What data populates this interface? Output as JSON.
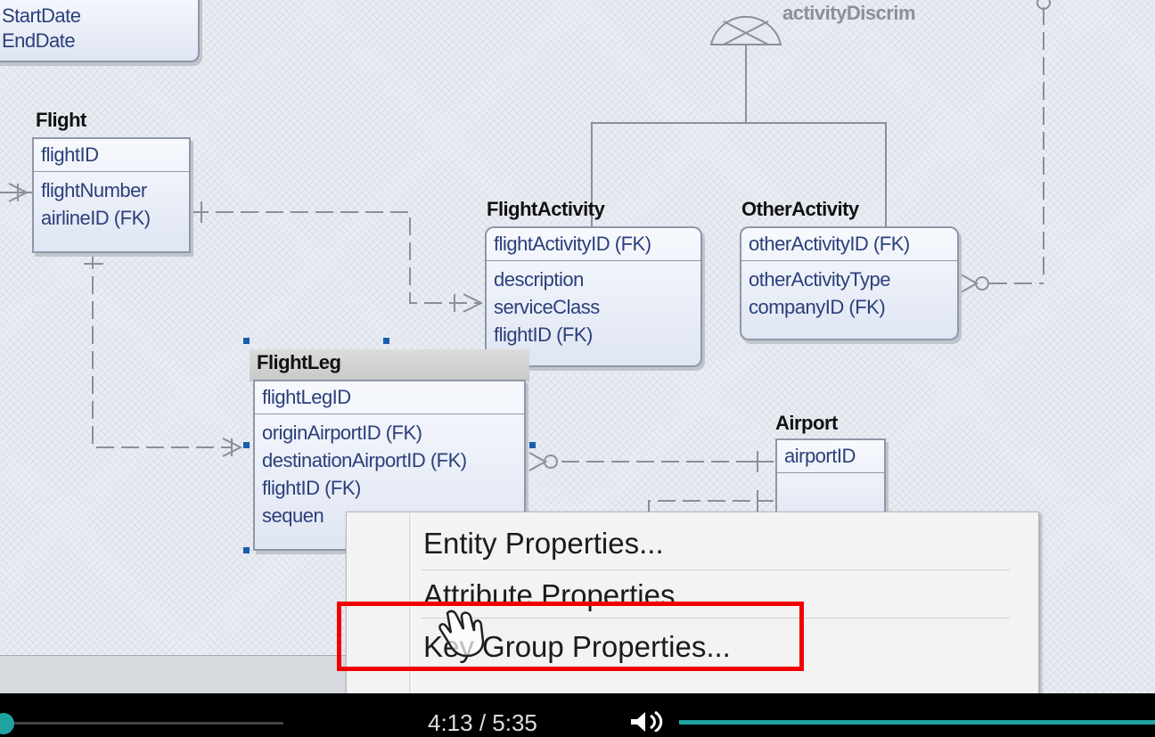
{
  "diagram": {
    "partial_entity": {
      "attributes": [
        "StartDate",
        "EndDate"
      ]
    },
    "discriminator_label": "activityDiscrim",
    "entities": {
      "flight": {
        "name": "Flight",
        "key": "flightID",
        "attributes": [
          "flightNumber",
          "airlineID (FK)"
        ]
      },
      "flight_activity": {
        "name": "FlightActivity",
        "key": "flightActivityID (FK)",
        "attributes": [
          "description",
          "serviceClass",
          "flightID (FK)"
        ]
      },
      "other_activity": {
        "name": "OtherActivity",
        "key": "otherActivityID (FK)",
        "attributes": [
          "otherActivityType",
          "companyID (FK)"
        ]
      },
      "flight_leg": {
        "name": "FlightLeg",
        "key": "flightLegID",
        "attributes": [
          "originAirportID (FK)",
          "destinationAirportID (FK)",
          "flightID (FK)",
          "sequen"
        ]
      },
      "airport": {
        "name": "Airport",
        "key": "airportID"
      }
    },
    "colors": {
      "entity_text": "#2b3f7a",
      "selection_handle": "#1a5db0",
      "highlight": "#f20000"
    }
  },
  "context_menu": {
    "items": [
      "Entity Properties...",
      "Attribute Properties",
      "Key Group Properties..."
    ]
  },
  "player": {
    "timecode": "4:13 / 5:35",
    "progress_fraction": 0.755,
    "accent": "#1fa3a1",
    "volume_icon": "volume-icon"
  }
}
